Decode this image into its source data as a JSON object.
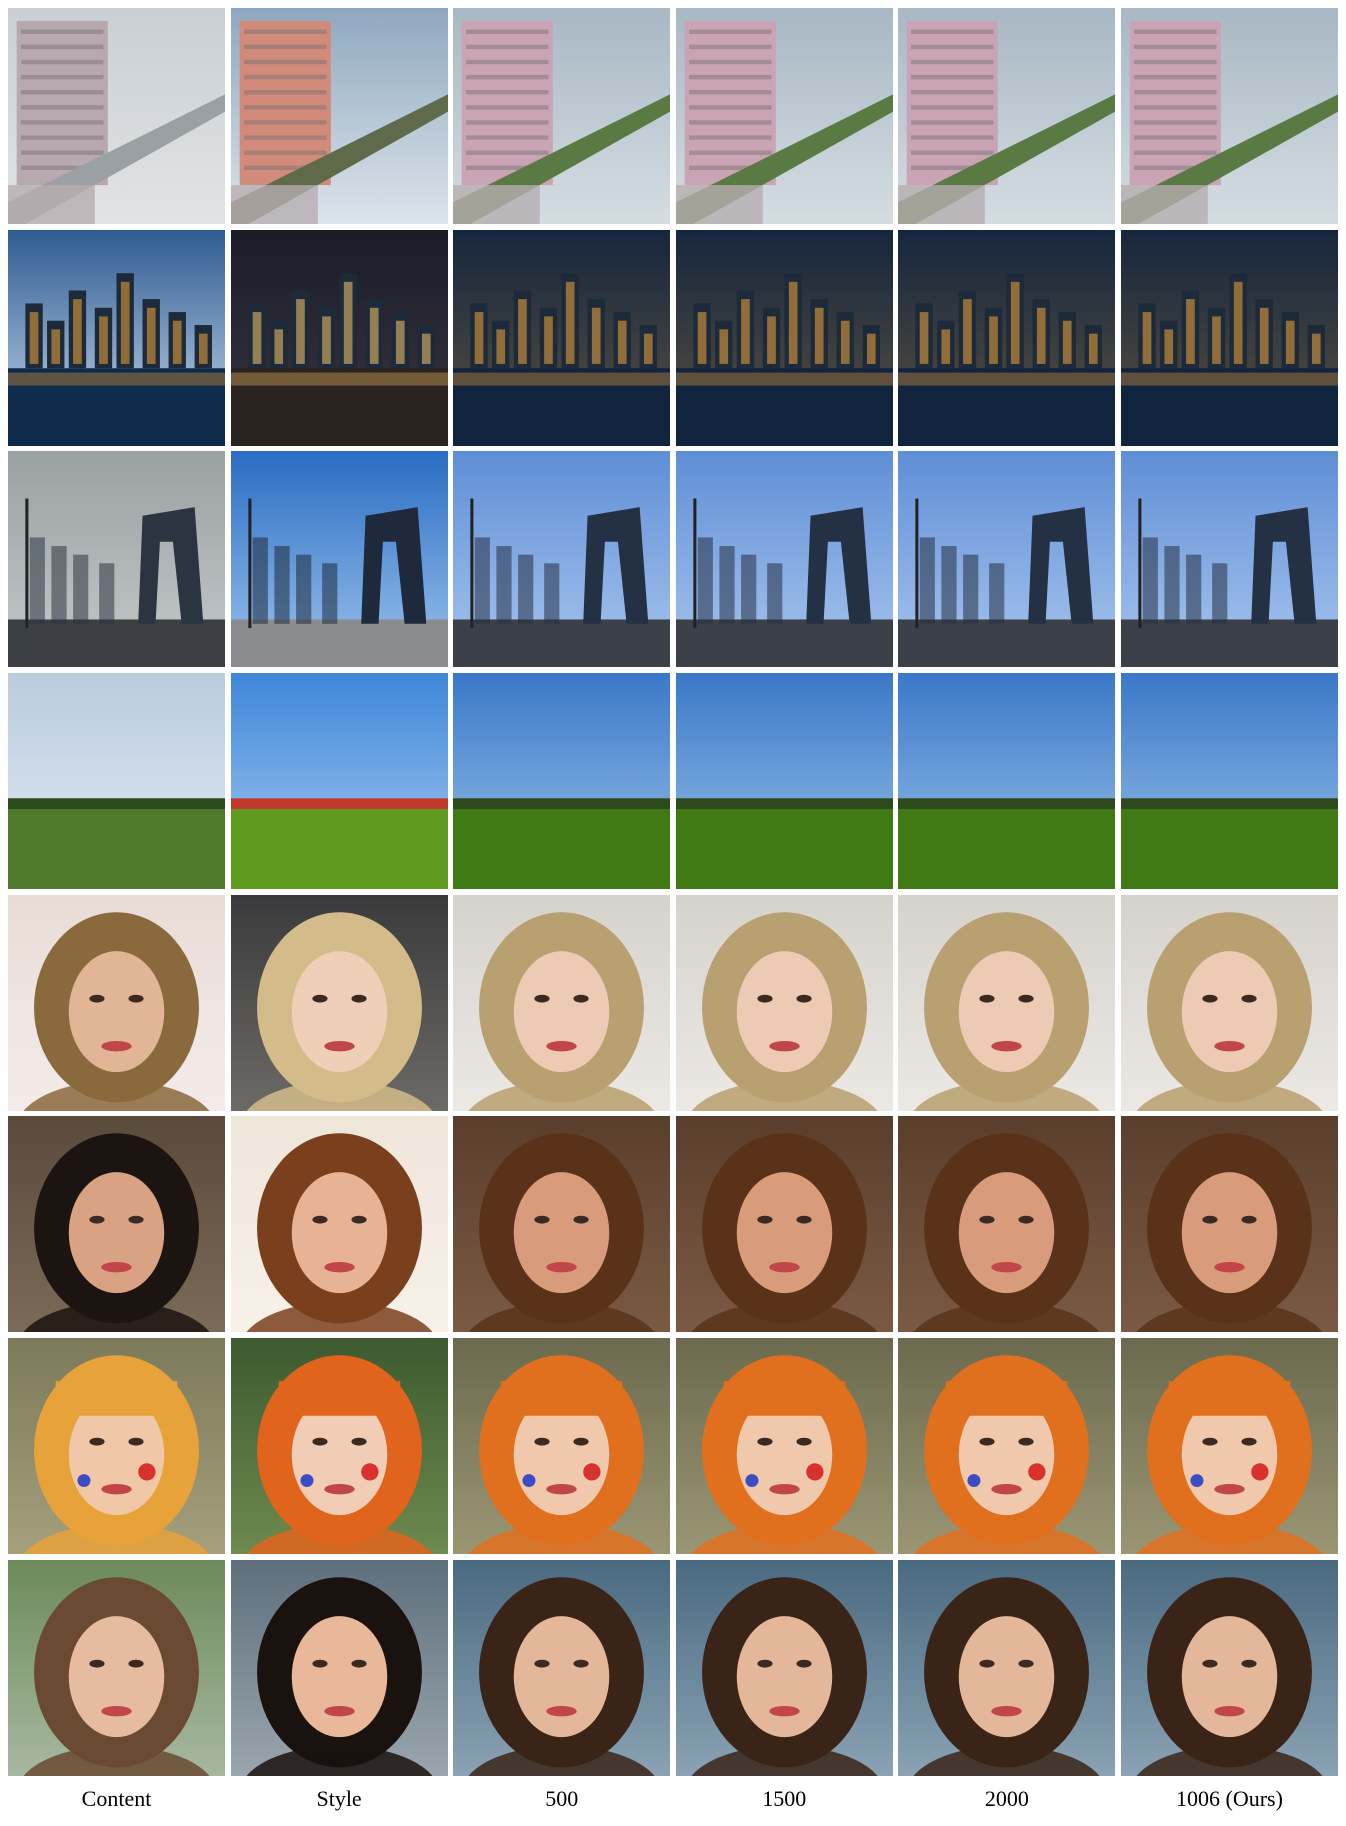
{
  "columns": [
    "Content",
    "Style",
    "500",
    "1500",
    "2000",
    "1006 (Ours)"
  ],
  "rows": [
    {
      "scene": "city-train",
      "sky": [
        "#c9cfd4",
        "#e1e4e6"
      ],
      "ground": "#9aa0a3",
      "accent": "#b8a8b0"
    },
    {
      "scene": "night-skyline",
      "sky": [
        "#2f5c91",
        "#c9dbef"
      ],
      "ground": "#0f2a4a",
      "accent": "#f2a43a"
    },
    {
      "scene": "cctv-building",
      "sky": [
        "#9aa1a3",
        "#c4c8c9"
      ],
      "ground": "#3c3f44",
      "accent": "#2b3440"
    },
    {
      "scene": "field",
      "sky": [
        "#b9cbdf",
        "#e3ebf3"
      ],
      "ground": "#4f7a2c",
      "accent": "#2d4a1c"
    },
    {
      "scene": "portrait-blonde",
      "sky": [
        "#e8dcd6",
        "#f4ecea"
      ],
      "ground": "#8a6a3c",
      "accent": "#e2b596"
    },
    {
      "scene": "portrait-dark",
      "sky": [
        "#5a4a3c",
        "#7c6a58"
      ],
      "ground": "#1c1410",
      "accent": "#d9a383"
    },
    {
      "scene": "portrait-child-paint",
      "sky": [
        "#7c7a5a",
        "#a59f7c"
      ],
      "ground": "#e8a23a",
      "accent": "#f0c8a8"
    },
    {
      "scene": "portrait-girl",
      "sky": [
        "#6c8a5a",
        "#a7b8a0"
      ],
      "ground": "#6a4a32",
      "accent": "#e6bba0"
    }
  ],
  "column_styles": [
    {
      "tone": "content"
    },
    {
      "tone": "style"
    },
    {
      "tone": "result"
    },
    {
      "tone": "result"
    },
    {
      "tone": "result"
    },
    {
      "tone": "result"
    }
  ],
  "style_rows": [
    {
      "sky": [
        "#8fa8c0",
        "#dce4ea"
      ],
      "ground": "#5f6a4a",
      "accent": "#d28a7a"
    },
    {
      "sky": [
        "#1a1c28",
        "#3a3540"
      ],
      "ground": "#2a2420",
      "accent": "#f7c46a"
    },
    {
      "sky": [
        "#2a6cc2",
        "#9cc4ee"
      ],
      "ground": "#8a8c90",
      "accent": "#1e2a3c"
    },
    {
      "sky": [
        "#3f86d9",
        "#a8cdf2"
      ],
      "ground": "#5e9a1e",
      "accent": "#c0392b"
    },
    {
      "sky": [
        "#3a3a3c",
        "#6c6a66"
      ],
      "ground": "#d4bc8a",
      "accent": "#efcfb8"
    },
    {
      "sky": [
        "#efe6da",
        "#f7f1e9"
      ],
      "ground": "#7a3f1c",
      "accent": "#e8b394"
    },
    {
      "sky": [
        "#3d5a30",
        "#6e8a4e"
      ],
      "ground": "#e0641c",
      "accent": "#f2cdb6"
    },
    {
      "sky": [
        "#5e6f7c",
        "#9aa6ae"
      ],
      "ground": "#1a120e",
      "accent": "#e8b898"
    }
  ],
  "result_rows": [
    {
      "sky": [
        "#a8b8c4",
        "#d5dde2"
      ],
      "ground": "#5a7a44",
      "accent": "#caa4b4"
    },
    {
      "sky": [
        "#16263e",
        "#5a5240"
      ],
      "ground": "#10243e",
      "accent": "#f2a43a"
    },
    {
      "sky": [
        "#5f8ed6",
        "#a8c6ee"
      ],
      "ground": "#3c4048",
      "accent": "#243044"
    },
    {
      "sky": [
        "#3a78c8",
        "#9ec4ea"
      ],
      "ground": "#3f7a14",
      "accent": "#2d4a1c"
    },
    {
      "sky": [
        "#d6d2cc",
        "#ece8e4"
      ],
      "ground": "#b8a070",
      "accent": "#eccab4"
    },
    {
      "sky": [
        "#5a3e2c",
        "#7a5a44"
      ],
      "ground": "#5a321a",
      "accent": "#d89c7c"
    },
    {
      "sky": [
        "#6c6a4e",
        "#9a9674"
      ],
      "ground": "#e0701e",
      "accent": "#f0c8ac"
    },
    {
      "sky": [
        "#4a6a80",
        "#8aa2b4"
      ],
      "ground": "#3a2418",
      "accent": "#e4b69a"
    }
  ]
}
